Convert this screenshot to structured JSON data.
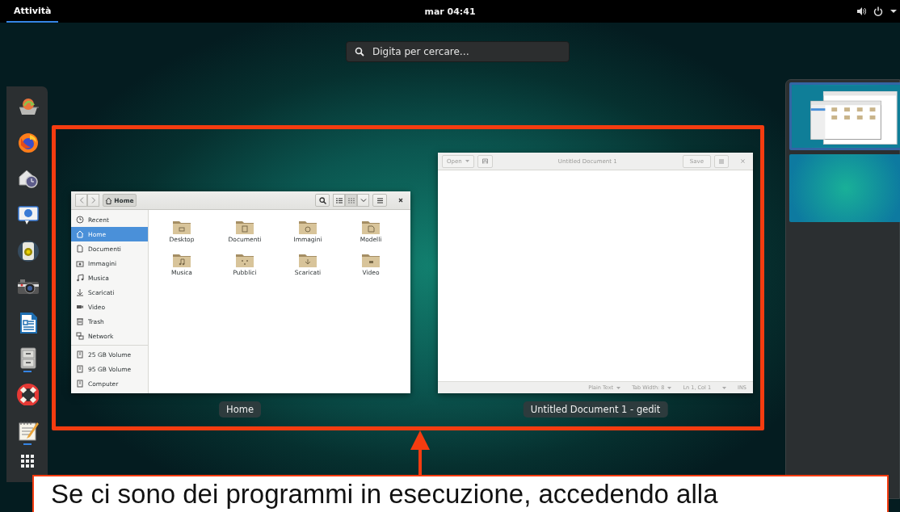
{
  "top_bar": {
    "activities": "Attività",
    "clock": "mar 04:41"
  },
  "search": {
    "placeholder": "Digita per cercare…"
  },
  "dock": {
    "apps": [
      {
        "running": false
      },
      {
        "running": false
      },
      {
        "running": false
      },
      {
        "running": false
      },
      {
        "running": false
      },
      {
        "running": false
      },
      {
        "running": false
      },
      {
        "running": true
      },
      {
        "running": false
      },
      {
        "running": true
      }
    ]
  },
  "files_window": {
    "path": "Home",
    "caption": "Home",
    "view_buttons": [
      {
        "kind": "list",
        "selected": false
      },
      {
        "kind": "grid",
        "selected": true
      }
    ],
    "places": [
      {
        "label": "Recent",
        "selected": false
      },
      {
        "label": "Home",
        "selected": true
      },
      {
        "label": "Documenti",
        "selected": false
      },
      {
        "label": "Immagini",
        "selected": false
      },
      {
        "label": "Musica",
        "selected": false
      },
      {
        "label": "Scaricati",
        "selected": false
      },
      {
        "label": "Video",
        "selected": false
      },
      {
        "label": "Trash",
        "selected": false
      },
      {
        "label": "Network",
        "selected": false
      }
    ],
    "devices": [
      {
        "label": "25 GB Volume",
        "selected": false
      },
      {
        "label": "95 GB Volume",
        "selected": false
      },
      {
        "label": "Computer",
        "selected": false
      }
    ],
    "folders": [
      {
        "label": "Desktop"
      },
      {
        "label": "Documenti"
      },
      {
        "label": "Immagini"
      },
      {
        "label": "Modelli"
      },
      {
        "label": "Musica"
      },
      {
        "label": "Pubblici"
      },
      {
        "label": "Scaricati"
      },
      {
        "label": "Video"
      }
    ]
  },
  "editor_window": {
    "title": "Untitled Document 1",
    "open_button": "Open",
    "save_button": "Save",
    "caption": "Untitled Document 1 - gedit",
    "status_bar": [
      {
        "kind": "menu",
        "label": "Plain Text"
      },
      {
        "kind": "menu",
        "label": "Tab Width: 8"
      },
      {
        "kind": "text",
        "label": "Ln 1, Col 1"
      },
      {
        "kind": "mode",
        "label": "INS"
      }
    ]
  },
  "workspaces": [
    {
      "selected": true
    },
    {
      "selected": false
    }
  ],
  "annotation": {
    "callout": "Se ci sono dei programmi in esecuzione, accedendo alla"
  }
}
